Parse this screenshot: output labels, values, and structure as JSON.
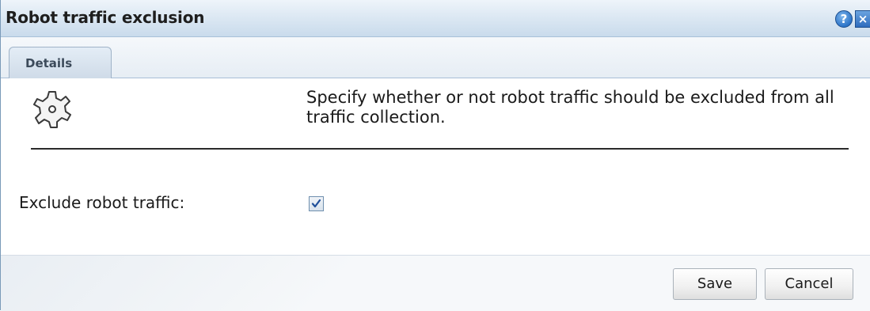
{
  "dialog": {
    "title": "Robot traffic exclusion",
    "help_glyph": "?",
    "close_glyph": "×",
    "icons": {
      "help": "help-icon",
      "close": "close-icon",
      "settings": "gear-icon",
      "check": "checkmark-icon"
    }
  },
  "tabs": [
    {
      "label": "Details",
      "active": true
    }
  ],
  "details": {
    "description": "Specify whether or not robot traffic should be excluded from all traffic collection.",
    "exclude_label": "Exclude robot traffic:",
    "exclude_checked": true
  },
  "footer": {
    "save_label": "Save",
    "cancel_label": "Cancel"
  },
  "colors": {
    "titlebar": "#d9e6f2",
    "accent": "#2c74c8",
    "text": "#1a1a1a"
  }
}
